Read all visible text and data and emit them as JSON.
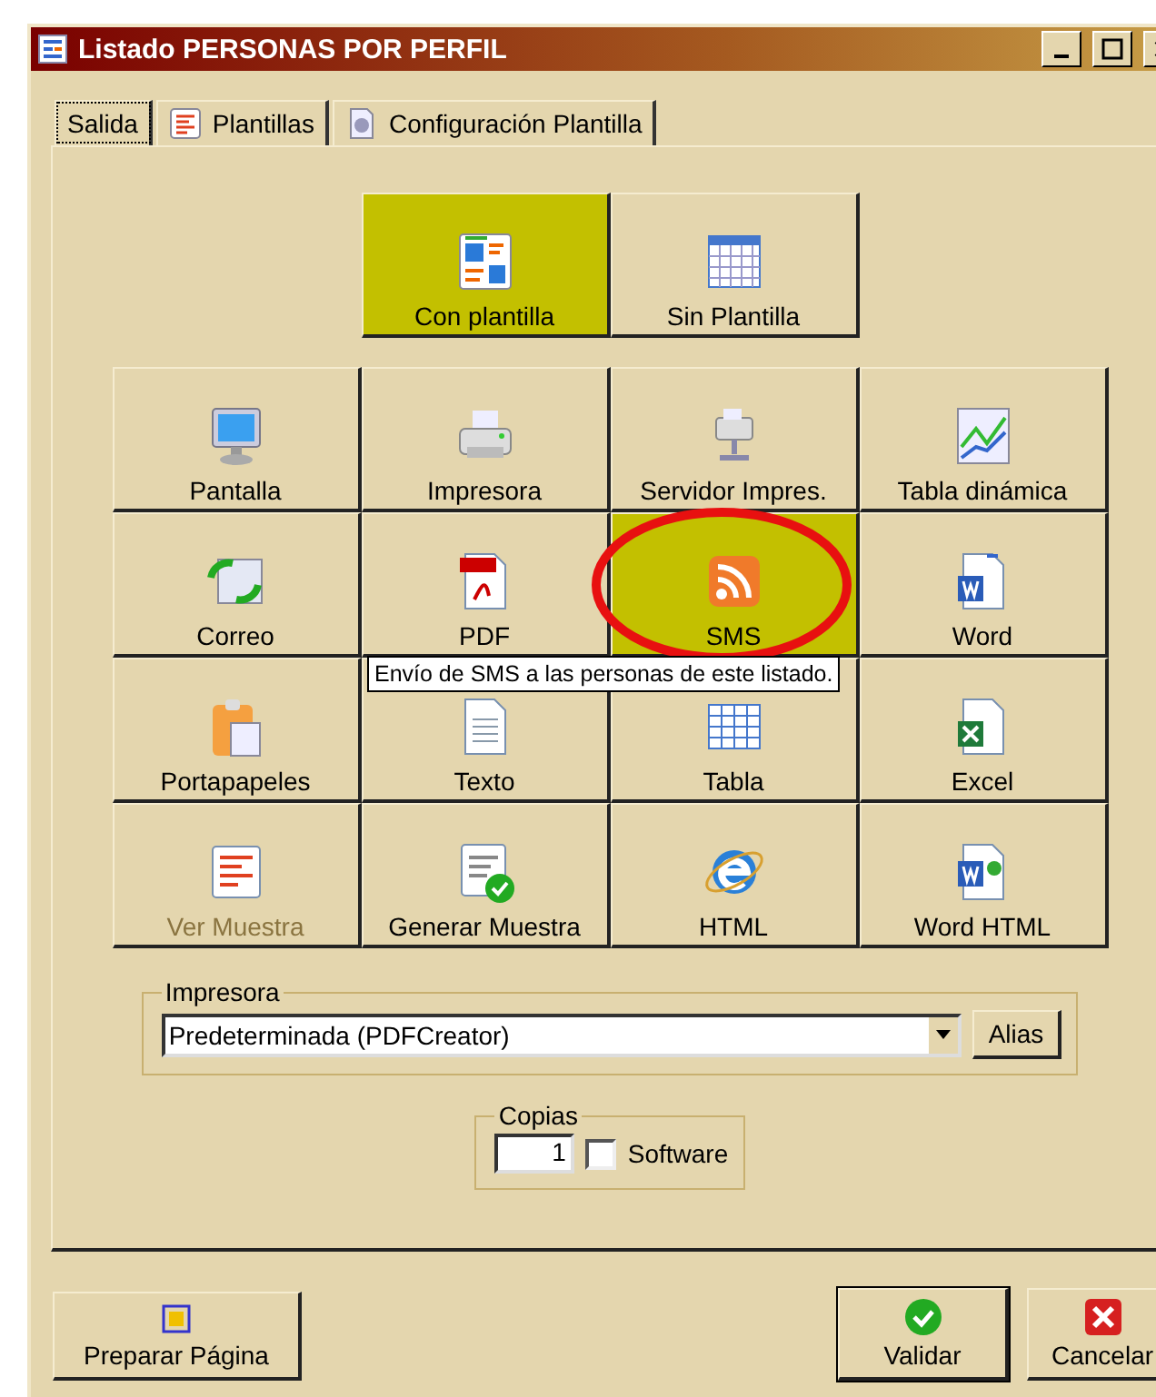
{
  "window": {
    "title": "Listado PERSONAS POR PERFIL"
  },
  "tabs": [
    {
      "label": "Salida",
      "selected": true
    },
    {
      "label": "Plantillas",
      "selected": false
    },
    {
      "label": "Configuración Plantilla",
      "selected": false
    }
  ],
  "template_modes": [
    {
      "label": "Con plantilla",
      "selected": true
    },
    {
      "label": "Sin Plantilla",
      "selected": false
    }
  ],
  "outputs": [
    {
      "label": "Pantalla",
      "selected": false,
      "disabled": false
    },
    {
      "label": "Impresora",
      "selected": false,
      "disabled": false
    },
    {
      "label": "Servidor Impres.",
      "selected": false,
      "disabled": false
    },
    {
      "label": "Tabla dinámica",
      "selected": false,
      "disabled": false
    },
    {
      "label": "Correo",
      "selected": false,
      "disabled": false
    },
    {
      "label": "PDF",
      "selected": false,
      "disabled": false
    },
    {
      "label": "SMS",
      "selected": true,
      "disabled": false
    },
    {
      "label": "Word",
      "selected": false,
      "disabled": false
    },
    {
      "label": "Portapapeles",
      "selected": false,
      "disabled": false
    },
    {
      "label": "Texto",
      "selected": false,
      "disabled": false
    },
    {
      "label": "Tabla",
      "selected": false,
      "disabled": false
    },
    {
      "label": "Excel",
      "selected": false,
      "disabled": false
    },
    {
      "label": "Ver Muestra",
      "selected": false,
      "disabled": true
    },
    {
      "label": "Generar  Muestra",
      "selected": false,
      "disabled": false
    },
    {
      "label": "HTML",
      "selected": false,
      "disabled": false
    },
    {
      "label": "Word HTML",
      "selected": false,
      "disabled": false
    }
  ],
  "tooltip": "Envío de SMS a las personas  de este listado.",
  "printer": {
    "legend": "Impresora",
    "value": "Predeterminada (PDFCreator)",
    "alias_button": "Alias"
  },
  "copies": {
    "legend": "Copias",
    "value": "1",
    "software": {
      "label": "Software",
      "checked": false
    }
  },
  "buttons": [
    {
      "label": "Preparar Página"
    },
    {
      "label": "Validar"
    },
    {
      "label": "Cancelar"
    }
  ]
}
